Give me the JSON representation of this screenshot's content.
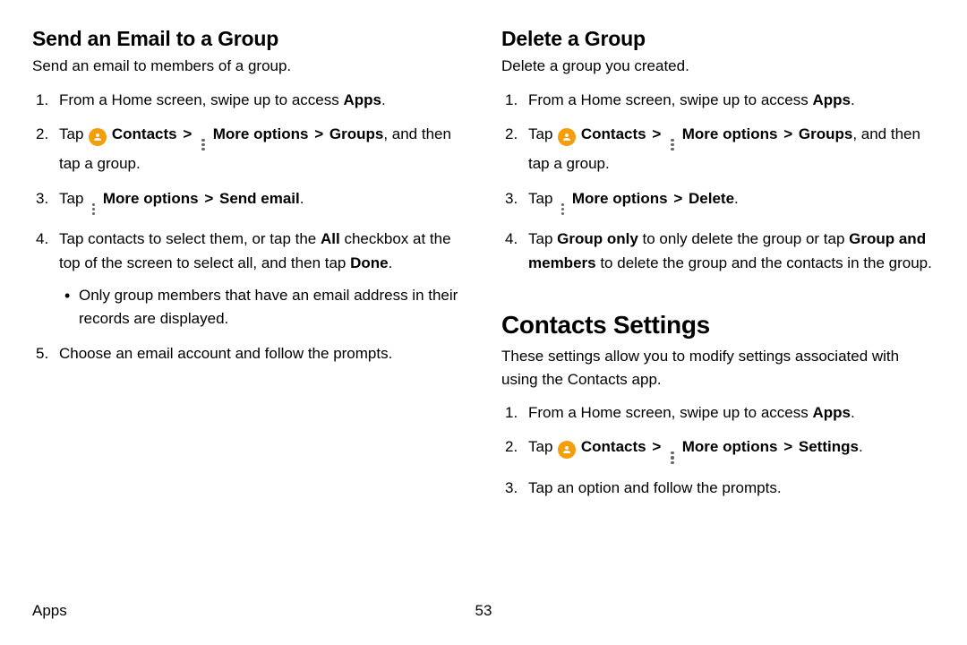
{
  "left": {
    "title": "Send an Email to a Group",
    "intro": "Send an email to members of a group.",
    "step1_a": "From a Home screen, swipe up to access ",
    "step1_b": "Apps",
    "step1_c": ".",
    "step2_tap": "Tap ",
    "step2_contacts": "Contacts",
    "step2_more": "More options",
    "step2_groups": "Groups",
    "step2_tail": ", and then tap a group.",
    "step3_tap": "Tap ",
    "step3_more": "More options",
    "step3_send": "Send email",
    "step3_period": ".",
    "step4_a": "Tap contacts to select them, or tap the ",
    "step4_all": "All",
    "step4_b": " checkbox at the top of the screen to select all, and then tap ",
    "step4_done": "Done",
    "step4_c": ".",
    "step4_sub": "Only group members that have an email address in their records are displayed.",
    "step5": "Choose an email account and follow the prompts."
  },
  "right": {
    "title": "Delete a Group",
    "intro": "Delete a group you created.",
    "step1_a": "From a Home screen, swipe up to access ",
    "step1_b": "Apps",
    "step1_c": ".",
    "step2_tap": "Tap ",
    "step2_contacts": "Contacts",
    "step2_more": "More options",
    "step2_groups": "Groups",
    "step2_tail": ", and then tap a group.",
    "step3_tap": "Tap ",
    "step3_more": "More options",
    "step3_delete": "Delete",
    "step3_period": ".",
    "step4_a": "Tap ",
    "step4_go": "Group only",
    "step4_b": " to only delete the group or tap ",
    "step4_gm": "Group and members",
    "step4_c": " to delete the group and the contacts in the group."
  },
  "settings": {
    "title": "Contacts Settings",
    "intro": "These settings allow you to modify settings associated with using the Contacts app.",
    "step1_a": "From a Home screen, swipe up to access ",
    "step1_b": "Apps",
    "step1_c": ".",
    "step2_tap": "Tap ",
    "step2_contacts": "Contacts",
    "step2_more": "More options",
    "step2_settings": "Settings",
    "step2_period": ".",
    "step3": "Tap an option and follow the prompts."
  },
  "footer": {
    "section": "Apps",
    "page": "53"
  },
  "glyphs": {
    "chevron": ">"
  }
}
